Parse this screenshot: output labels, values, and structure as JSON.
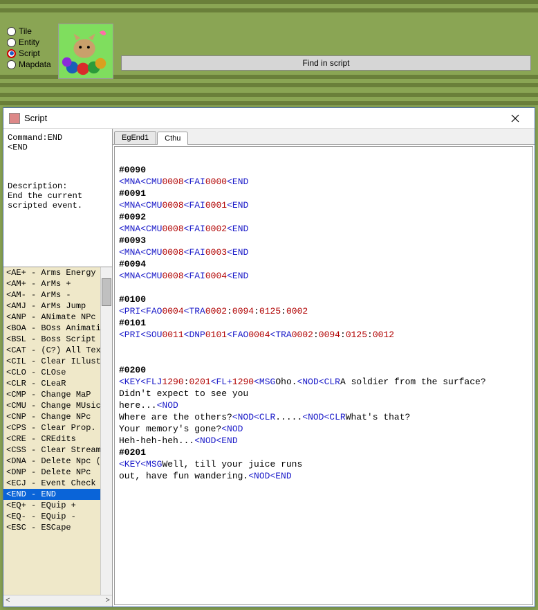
{
  "toolbar": {
    "radios": [
      {
        "label": "Tile",
        "selected": false
      },
      {
        "label": "Entity",
        "selected": false
      },
      {
        "label": "Script",
        "selected": true
      },
      {
        "label": "Mapdata",
        "selected": false
      }
    ],
    "find_label": "Find in script"
  },
  "window": {
    "title": "Script",
    "info": {
      "command_label": "Command:",
      "command": "END",
      "end_tag": "<END",
      "desc_label": "Description:",
      "description": "End the current scripted event."
    },
    "commands": [
      "<AE+ - Arms Energy +",
      "<AM+ - ArMs +",
      "<AM- - ArMs -",
      "<AMJ - ArMs Jump",
      "<ANP - ANimate NPc",
      "<BOA - BOss Animation",
      "<BSL - Boss Script L",
      "<CAT - (C?) All Text",
      "<CIL - Clear ILlustr",
      "<CLO - CLOse",
      "<CLR - CLeaR",
      "<CMP - Change MaP",
      "<CMU - Change MUsic",
      "<CNP - Change NPc",
      "<CPS - Clear Prop. S",
      "<CRE - CREdits",
      "<CSS - Clear Stream",
      "<DNA - Delete Npc (A",
      "<DNP - Delete NPc",
      "<ECJ - Event Check J",
      "<END - END",
      "<EQ+ - EQuip +",
      "<EQ- - EQuip -",
      "<ESC - ESCape"
    ],
    "selected_command_index": 20,
    "tabs": [
      {
        "label": "EgEnd1",
        "active": false
      },
      {
        "label": "Cthu",
        "active": true
      }
    ],
    "script_lines": [
      {
        "t": "blank"
      },
      {
        "t": "event",
        "v": "#0090"
      },
      {
        "t": "tokens",
        "v": [
          [
            "cmd",
            "<MNA"
          ],
          [
            "cmd",
            "<CMU"
          ],
          [
            "num",
            "0008"
          ],
          [
            "cmd",
            "<FAI"
          ],
          [
            "num",
            "0000"
          ],
          [
            "cmd",
            "<END"
          ]
        ]
      },
      {
        "t": "event",
        "v": "#0091"
      },
      {
        "t": "tokens",
        "v": [
          [
            "cmd",
            "<MNA"
          ],
          [
            "cmd",
            "<CMU"
          ],
          [
            "num",
            "0008"
          ],
          [
            "cmd",
            "<FAI"
          ],
          [
            "num",
            "0001"
          ],
          [
            "cmd",
            "<END"
          ]
        ]
      },
      {
        "t": "event",
        "v": "#0092"
      },
      {
        "t": "tokens",
        "v": [
          [
            "cmd",
            "<MNA"
          ],
          [
            "cmd",
            "<CMU"
          ],
          [
            "num",
            "0008"
          ],
          [
            "cmd",
            "<FAI"
          ],
          [
            "num",
            "0002"
          ],
          [
            "cmd",
            "<END"
          ]
        ]
      },
      {
        "t": "event",
        "v": "#0093"
      },
      {
        "t": "tokens",
        "v": [
          [
            "cmd",
            "<MNA"
          ],
          [
            "cmd",
            "<CMU"
          ],
          [
            "num",
            "0008"
          ],
          [
            "cmd",
            "<FAI"
          ],
          [
            "num",
            "0003"
          ],
          [
            "cmd",
            "<END"
          ]
        ]
      },
      {
        "t": "event",
        "v": "#0094"
      },
      {
        "t": "tokens",
        "v": [
          [
            "cmd",
            "<MNA"
          ],
          [
            "cmd",
            "<CMU"
          ],
          [
            "num",
            "0008"
          ],
          [
            "cmd",
            "<FAI"
          ],
          [
            "num",
            "0004"
          ],
          [
            "cmd",
            "<END"
          ]
        ]
      },
      {
        "t": "blank"
      },
      {
        "t": "event",
        "v": "#0100"
      },
      {
        "t": "tokens",
        "v": [
          [
            "cmd",
            "<PRI"
          ],
          [
            "cmd",
            "<FAO"
          ],
          [
            "num",
            "0004"
          ],
          [
            "cmd",
            "<TRA"
          ],
          [
            "num",
            "0002"
          ],
          [
            "text",
            ":"
          ],
          [
            "num",
            "0094"
          ],
          [
            "text",
            ":"
          ],
          [
            "num",
            "0125"
          ],
          [
            "text",
            ":"
          ],
          [
            "num",
            "0002"
          ]
        ]
      },
      {
        "t": "event",
        "v": "#0101"
      },
      {
        "t": "tokens",
        "v": [
          [
            "cmd",
            "<PRI"
          ],
          [
            "cmd",
            "<SOU"
          ],
          [
            "num",
            "0011"
          ],
          [
            "cmd",
            "<DNP"
          ],
          [
            "num",
            "0101"
          ],
          [
            "cmd",
            "<FAO"
          ],
          [
            "num",
            "0004"
          ],
          [
            "cmd",
            "<TRA"
          ],
          [
            "num",
            "0002"
          ],
          [
            "text",
            ":"
          ],
          [
            "num",
            "0094"
          ],
          [
            "text",
            ":"
          ],
          [
            "num",
            "0125"
          ],
          [
            "text",
            ":"
          ],
          [
            "num",
            "0012"
          ]
        ]
      },
      {
        "t": "blank"
      },
      {
        "t": "blank"
      },
      {
        "t": "event",
        "v": "#0200"
      },
      {
        "t": "tokens",
        "v": [
          [
            "cmd",
            "<KEY"
          ],
          [
            "cmd",
            "<FLJ"
          ],
          [
            "num",
            "1290"
          ],
          [
            "text",
            ":"
          ],
          [
            "num",
            "0201"
          ],
          [
            "cmd",
            "<FL+"
          ],
          [
            "num",
            "1290"
          ],
          [
            "cmd",
            "<MSG"
          ],
          [
            "text",
            "Oho."
          ],
          [
            "cmd",
            "<NOD"
          ],
          [
            "cmd",
            "<CLR"
          ],
          [
            "text",
            "A soldier from the surface?"
          ]
        ]
      },
      {
        "t": "tokens",
        "v": [
          [
            "text",
            "Didn't expect to see you"
          ]
        ]
      },
      {
        "t": "tokens",
        "v": [
          [
            "text",
            "here..."
          ],
          [
            "cmd",
            "<NOD"
          ]
        ]
      },
      {
        "t": "tokens",
        "v": [
          [
            "text",
            "Where are the others?"
          ],
          [
            "cmd",
            "<NOD"
          ],
          [
            "cmd",
            "<CLR"
          ],
          [
            "text",
            "....."
          ],
          [
            "cmd",
            "<NOD"
          ],
          [
            "cmd",
            "<CLR"
          ],
          [
            "text",
            "What's that?"
          ]
        ]
      },
      {
        "t": "tokens",
        "v": [
          [
            "text",
            "Your memory's gone?"
          ],
          [
            "cmd",
            "<NOD"
          ]
        ]
      },
      {
        "t": "tokens",
        "v": [
          [
            "text",
            "Heh-heh-heh..."
          ],
          [
            "cmd",
            "<NOD"
          ],
          [
            "cmd",
            "<END"
          ]
        ]
      },
      {
        "t": "event",
        "v": "#0201"
      },
      {
        "t": "tokens",
        "v": [
          [
            "cmd",
            "<KEY"
          ],
          [
            "cmd",
            "<MSG"
          ],
          [
            "text",
            "Well, till your juice runs"
          ]
        ]
      },
      {
        "t": "tokens",
        "v": [
          [
            "text",
            "out, have fun wandering."
          ],
          [
            "cmd",
            "<NOD"
          ],
          [
            "cmd",
            "<END"
          ]
        ]
      }
    ]
  }
}
